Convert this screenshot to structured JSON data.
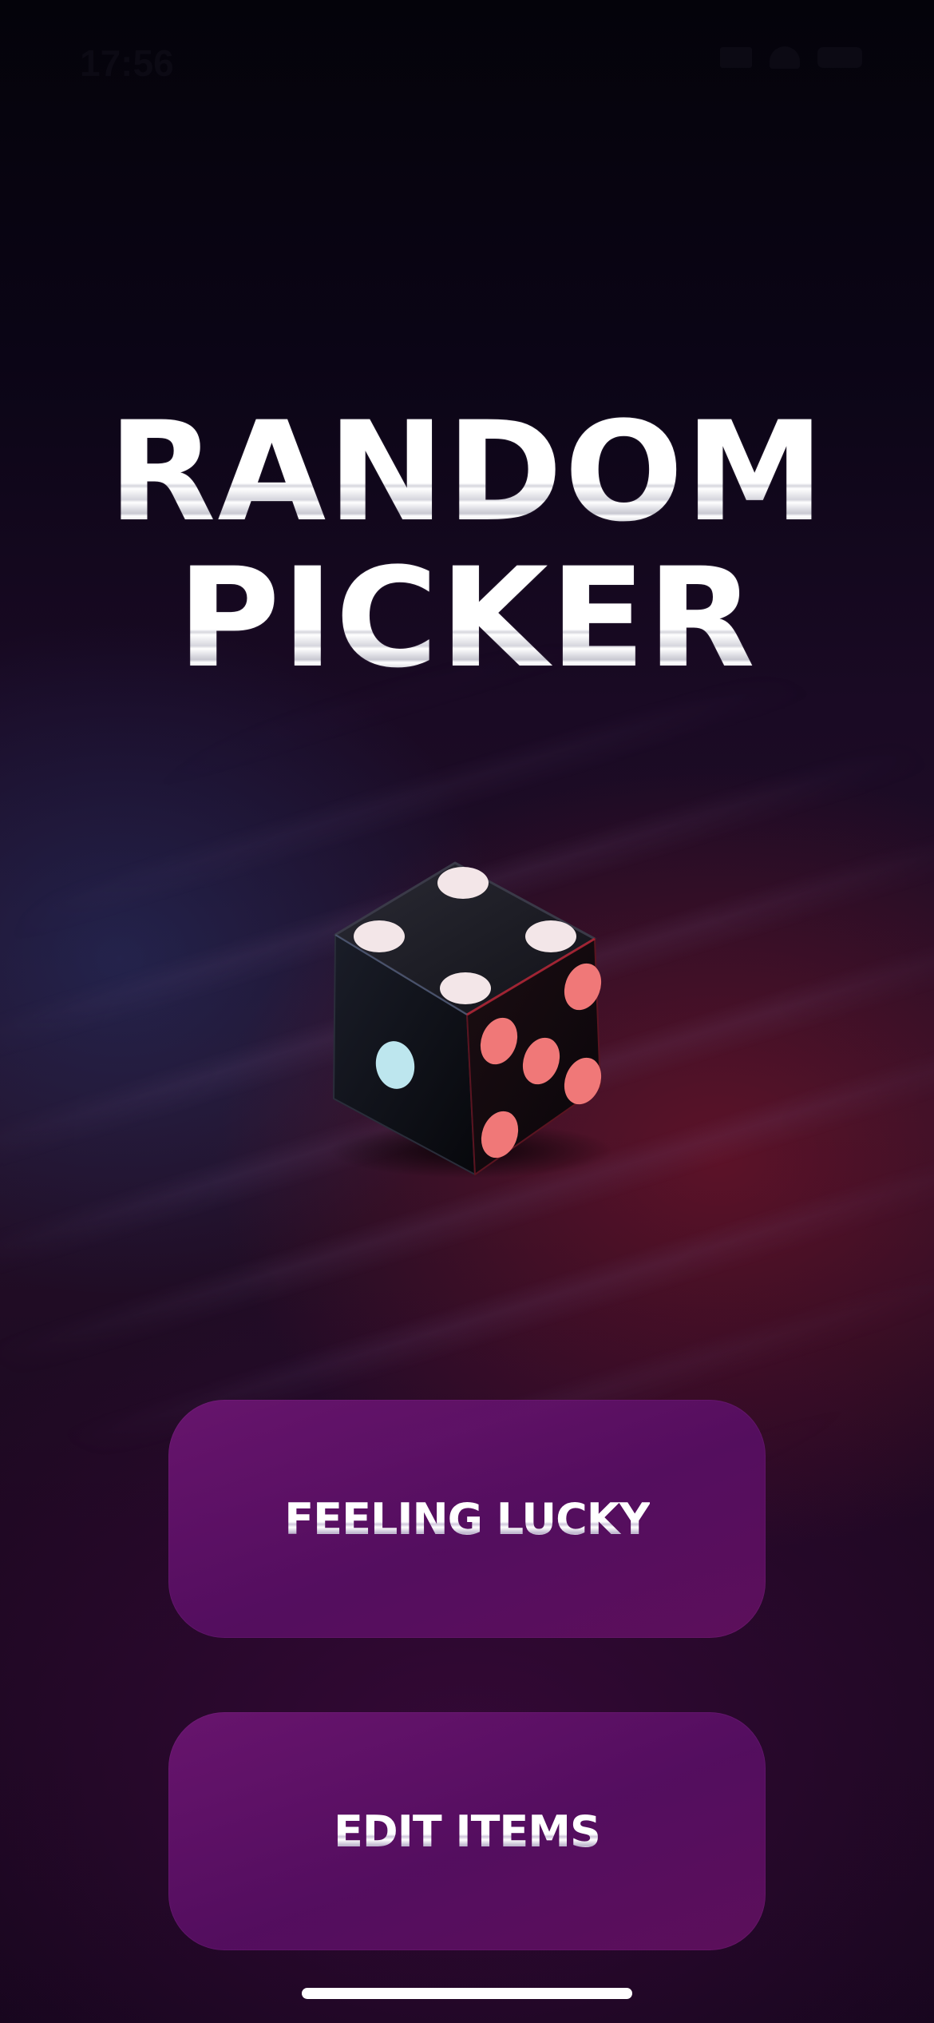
{
  "status_bar": {
    "time": "17:56",
    "icons": [
      "signal-icon",
      "wifi-icon",
      "battery-icon"
    ]
  },
  "title": {
    "line1": "RANDOM",
    "line2": "PICKER"
  },
  "hero": {
    "icon": "dice-icon",
    "pip_colors": {
      "top": "#f2e4e6",
      "left": "#bfe8f0",
      "right": "#f07a7a"
    }
  },
  "buttons": {
    "feeling_lucky": "FEELING LUCKY",
    "edit_items": "EDIT ITEMS"
  },
  "colors": {
    "button_fill": "#6a1270",
    "text": "#ffffff"
  }
}
